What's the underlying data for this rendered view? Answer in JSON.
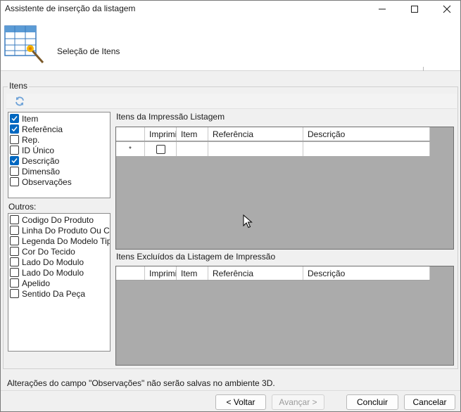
{
  "window": {
    "title": "Assistente de inserção da listagem"
  },
  "header": {
    "heading": "Seleção de Itens"
  },
  "group": {
    "label": "Itens"
  },
  "fields_list": {
    "items": [
      {
        "label": "Item",
        "checked": true
      },
      {
        "label": "Referência",
        "checked": true
      },
      {
        "label": "Rep.",
        "checked": false
      },
      {
        "label": "ID Único",
        "checked": false
      },
      {
        "label": "Descrição",
        "checked": true
      },
      {
        "label": "Dimensão",
        "checked": false
      },
      {
        "label": "Observações",
        "checked": false
      }
    ]
  },
  "others_list": {
    "label": "Outros:",
    "items": [
      {
        "label": "Codigo Do Produto",
        "checked": false
      },
      {
        "label": "Linha Do Produto Ou Coc",
        "checked": false
      },
      {
        "label": "Legenda Do Modelo Tipo",
        "checked": false
      },
      {
        "label": "Cor Do Tecido",
        "checked": false
      },
      {
        "label": "Lado Do Modulo",
        "checked": false
      },
      {
        "label": "Lado Do Modulo",
        "checked": false
      },
      {
        "label": "Apelido",
        "checked": false
      },
      {
        "label": "Sentido Da Peça",
        "checked": false
      }
    ]
  },
  "print_grid": {
    "label": "Itens da Impressão Listagem",
    "columns": [
      "Imprimir",
      "Item",
      "Referência",
      "Descrição"
    ],
    "new_row_marker": "*"
  },
  "excluded_grid": {
    "label": "Itens Excluídos da Listagem de Impressão",
    "columns": [
      "Imprimir",
      "Item",
      "Referência",
      "Descrição"
    ]
  },
  "status": {
    "message": "Alterações do campo \"Observações\" não serão salvas no ambiente 3D."
  },
  "buttons": {
    "back": "< Voltar",
    "next": "Avançar >",
    "finish": "Concluir",
    "cancel": "Cancelar"
  },
  "colors": {
    "accent": "#0067c0",
    "grid_background": "#ababab"
  }
}
